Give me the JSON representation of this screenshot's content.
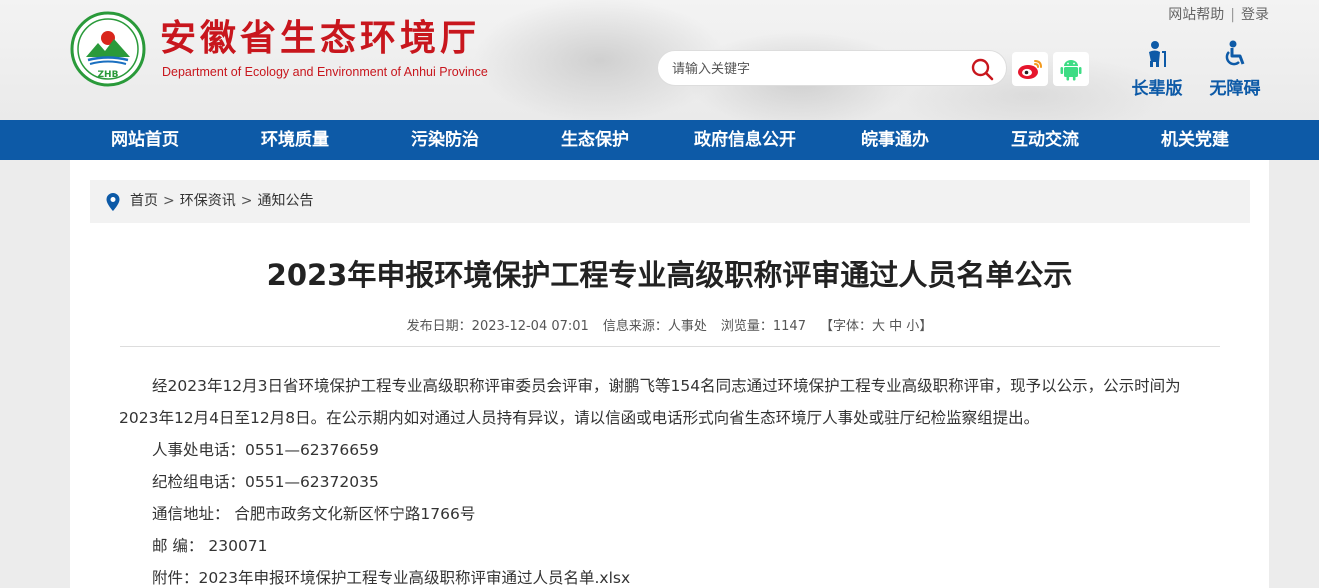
{
  "header": {
    "logo_text": "ZHB",
    "site_title": "安徽省生态环境厅",
    "site_subtitle": "Department of Ecology and Environment of Anhui Province",
    "top_links": {
      "help": "网站帮助",
      "separator": "|",
      "login": "登录"
    },
    "search": {
      "placeholder": "请输入关键字",
      "value": ""
    },
    "modes": {
      "elder": "长辈版",
      "barrier_free": "无障碍"
    },
    "colors": {
      "brand_red": "#c8161d",
      "nav_blue": "#0d5aa7"
    },
    "icons": [
      "search-icon",
      "weibo-icon",
      "android-icon",
      "elder-icon",
      "wheelchair-icon"
    ]
  },
  "nav": {
    "items": [
      {
        "label": "网站首页"
      },
      {
        "label": "环境质量"
      },
      {
        "label": "污染防治"
      },
      {
        "label": "生态保护"
      },
      {
        "label": "政府信息公开"
      },
      {
        "label": "皖事通办"
      },
      {
        "label": "互动交流"
      },
      {
        "label": "机关党建"
      }
    ]
  },
  "breadcrumb": {
    "items": [
      "首页",
      "环保资讯",
      "通知公告"
    ],
    "separator": ">"
  },
  "article": {
    "title": "2023年申报环境保护工程专业高级职称评审通过人员名单公示",
    "meta": {
      "date_label": "发布日期：",
      "date": "2023-12-04 07:01",
      "source_label": "信息来源：",
      "source": "人事处",
      "views_label": "浏览量：",
      "views": "1147",
      "font_open": "【字体：",
      "font_large": "大",
      "font_medium": "中",
      "font_small": "小",
      "font_close": "】"
    },
    "para1_line1": "经2023年12月3日省环境保护工程专业高级职称评审委员会评审，谢鹏飞等154名同志通过环境保护工程专业高级职称评审，现予以公示，公示时间为",
    "para1_line2": "2023年12月4日至12月8日。在公示期内如对通过人员持有异议，请以信函或电话形式向省生态环境厅人事处或驻厅纪检监察组提出。",
    "hr_phone": "人事处电话：0551—62376659",
    "discipline_phone": "纪检组电话：0551—62372035",
    "address": "通信地址： 合肥市政务文化新区怀宁路1766号",
    "postcode": "邮 编： 230071",
    "attachment_label": "附件：",
    "attachment_file": "2023年申报环境保护工程专业高级职称评审通过人员名单.xlsx"
  }
}
